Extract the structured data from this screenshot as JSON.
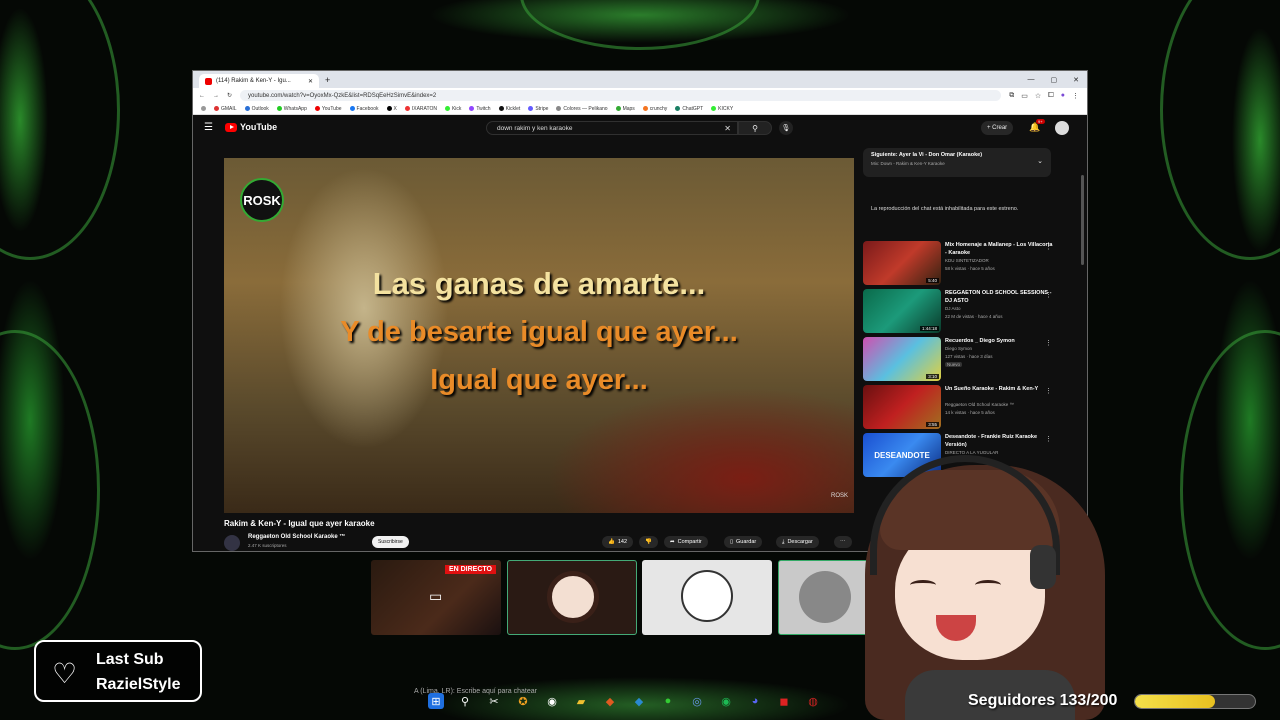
{
  "browser": {
    "tab_title": "(114) Rakim & Ken-Y - Igu...",
    "url": "youtube.com/watch?v=OyoxMx-QzkE&list=RDSqEeHzSimvE&index=2"
  },
  "bookmarks": [
    "GMAIL",
    "Outlook",
    "WhatsApp",
    "YouTube",
    "Facebook",
    "X",
    "IXARATON",
    "Kick",
    "Twitch",
    "Kicklet",
    "Stripe",
    "Colores — Pelikano",
    "Maps",
    "crunchy",
    "ChatGPT",
    "KICKY"
  ],
  "youtube": {
    "logo_text": "YouTube",
    "search_query": "down rakim y ken karaoke",
    "create_label": "+ Crear",
    "notifications": "9+"
  },
  "video": {
    "logo": "ROSK",
    "lyrics": [
      "Las ganas de amarte...",
      "Y de besarte igual que ayer...",
      "Igual que ayer..."
    ],
    "title": "Rakim & Ken-Y - Igual que ayer karaoke",
    "channel": "Reggaeton Old School Karaoke ™",
    "subscribers": "2.47 K suscriptores",
    "subscribe_label": "Suscribirse",
    "likes": "142",
    "share_label": "Compartir",
    "save_label": "Guardar",
    "download_label": "Descargar"
  },
  "sidebar": {
    "up_next_title": "Siguiente: Ayer la Vi - Don Omar (Karaoke)",
    "up_next_sub": "Mix: Down - Rakim & Ken-Y Karaoke",
    "chat_disabled": "La reproducción del chat está inhabilitada para este estreno.",
    "videos": [
      {
        "title": "Mix Homenaje a Mallanep - Los Villacorta - Karaoke",
        "channel": "KDU SINTETIZADOR",
        "meta": "58 k vistas · hace 5 años",
        "duration": "5:40"
      },
      {
        "title": "REGGAETON OLD SCHOOL SESSIONS - DJ ASTO",
        "channel": "DJ Asto",
        "meta": "22 M de vistas · hace 4 años",
        "duration": "1:44:18"
      },
      {
        "title": "Recuerdos _ Diego Symon",
        "channel": "Diego Symon",
        "meta": "127 vistas · hace 3 días",
        "duration": "3:10",
        "badge": "Nuevo"
      },
      {
        "title": "Un Sueño Karaoke - Rakim & Ken-Y",
        "channel": "Reggaeton Old School Karaoke ™",
        "meta": "14 k vistas · hace 5 años",
        "duration": "3:55"
      },
      {
        "title": "Deseandote - Frankie Ruiz Karaoke Versión)",
        "channel": "DIRECTO A LA YUGULAR",
        "thumb_text": "DESEANDOTE"
      }
    ]
  },
  "overlay": {
    "live_label": "EN DIRECTO",
    "last_sub_label": "Last Sub",
    "last_sub_name": "RazielStyle",
    "followers_label": "Seguidores 133/200",
    "followers_progress": 0.665,
    "chat_hint": "A (Lima, LR): Escribe aquí para chatear"
  },
  "colors": {
    "accent": "#3aa33a",
    "progress": "#f4e04a",
    "live": "#e01010",
    "youtube_red": "#ff0000"
  }
}
